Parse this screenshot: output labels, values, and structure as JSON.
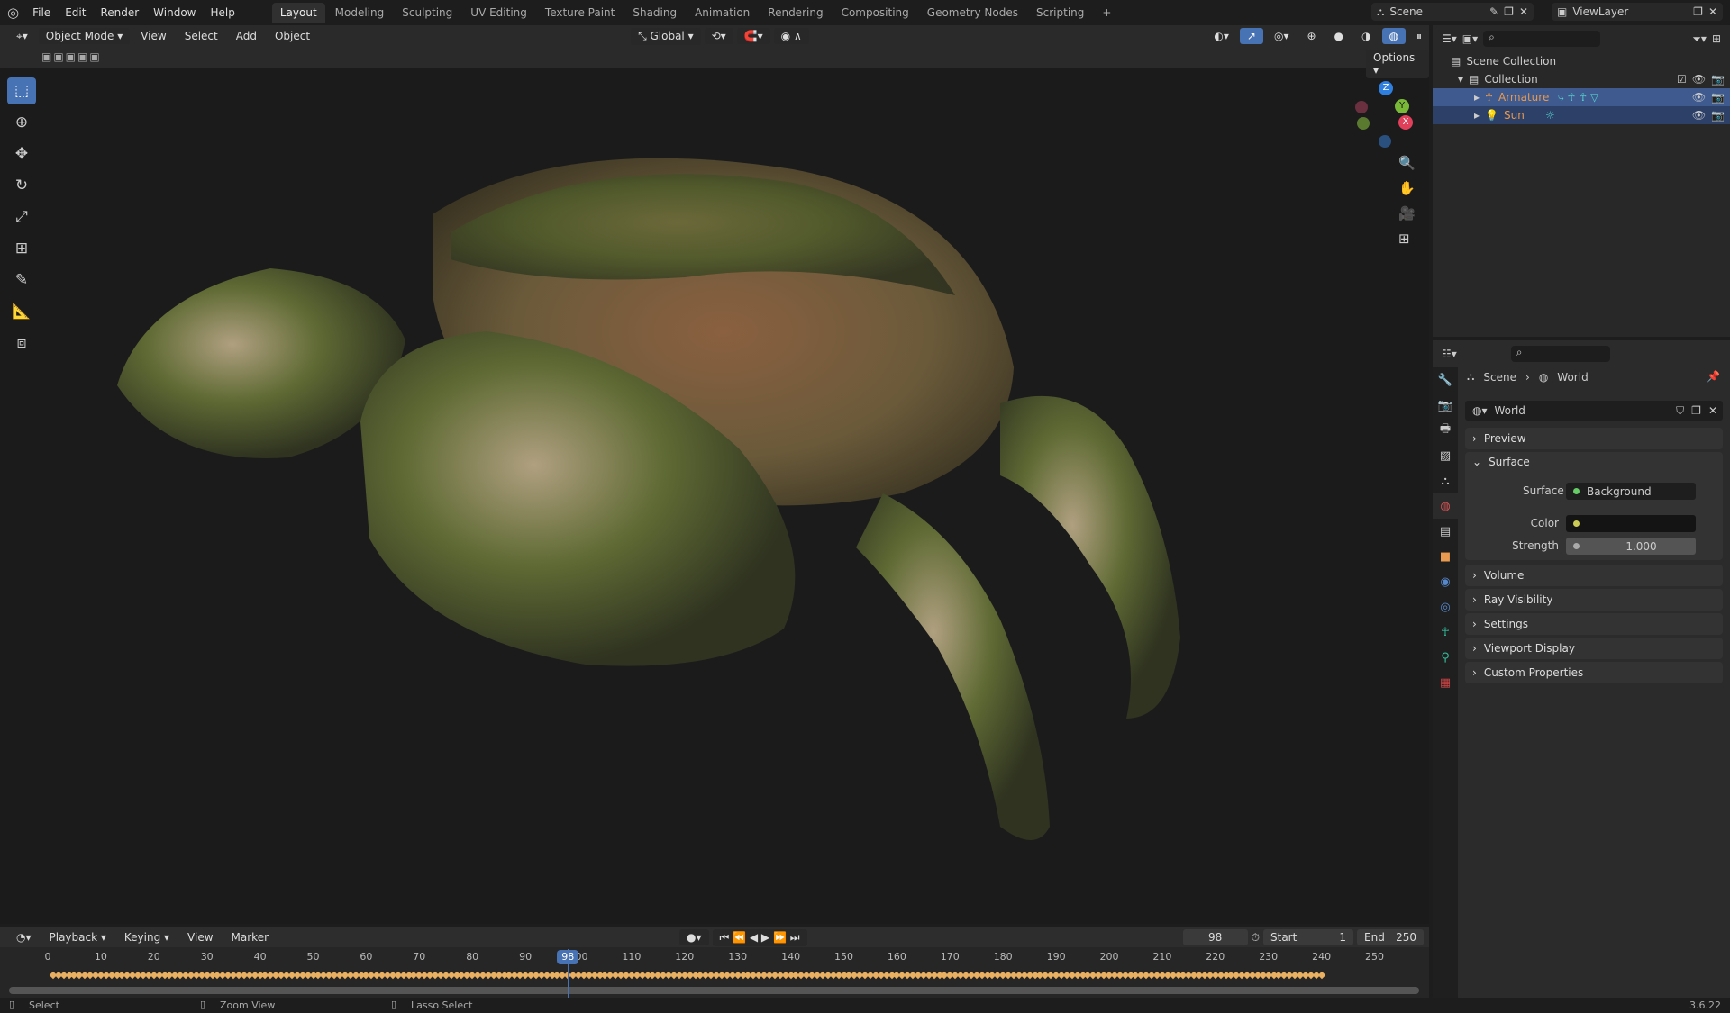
{
  "menu": [
    "File",
    "Edit",
    "Render",
    "Window",
    "Help"
  ],
  "workspaces": [
    "Layout",
    "Modeling",
    "Sculpting",
    "UV Editing",
    "Texture Paint",
    "Shading",
    "Animation",
    "Rendering",
    "Compositing",
    "Geometry Nodes",
    "Scripting",
    "+"
  ],
  "scene": "Scene",
  "view_layer": "ViewLayer",
  "viewport": {
    "mode": "Object Mode",
    "menus": [
      "View",
      "Select",
      "Add",
      "Object"
    ],
    "orientation": "Global",
    "options": "Options",
    "gizmo": {
      "z": "Z",
      "y": "Y",
      "x": "X"
    }
  },
  "outliner": {
    "scene_collection": "Scene Collection",
    "collection": "Collection",
    "items": [
      {
        "name": "Armature"
      },
      {
        "name": "Sun"
      }
    ]
  },
  "properties": {
    "breadcrumb": [
      "Scene",
      "World"
    ],
    "world_name": "World",
    "panels": [
      "Preview",
      "Surface",
      "Volume",
      "Ray Visibility",
      "Settings",
      "Viewport Display",
      "Custom Properties"
    ],
    "surface": {
      "surface_label": "Surface",
      "surface_value": "Background",
      "color_label": "Color",
      "strength_label": "Strength",
      "strength_value": "1.000"
    }
  },
  "timeline": {
    "menus": [
      "Playback",
      "Keying",
      "View",
      "Marker"
    ],
    "current_frame": "98",
    "start_label": "Start",
    "start": "1",
    "end_label": "End",
    "end": "250",
    "ticks": [
      "0",
      "10",
      "20",
      "30",
      "40",
      "50",
      "60",
      "70",
      "80",
      "90",
      "100",
      "110",
      "120",
      "130",
      "140",
      "150",
      "160",
      "170",
      "180",
      "190",
      "200",
      "210",
      "220",
      "230",
      "240",
      "250"
    ],
    "keyframe_range": [
      1,
      240
    ]
  },
  "status": {
    "select": "Select",
    "zoom": "Zoom View",
    "lasso": "Lasso Select",
    "version": "3.6.22"
  },
  "colors": {
    "accent": "#4772b3",
    "keyframe": "#e8b060",
    "object_name": "#e89a50"
  }
}
